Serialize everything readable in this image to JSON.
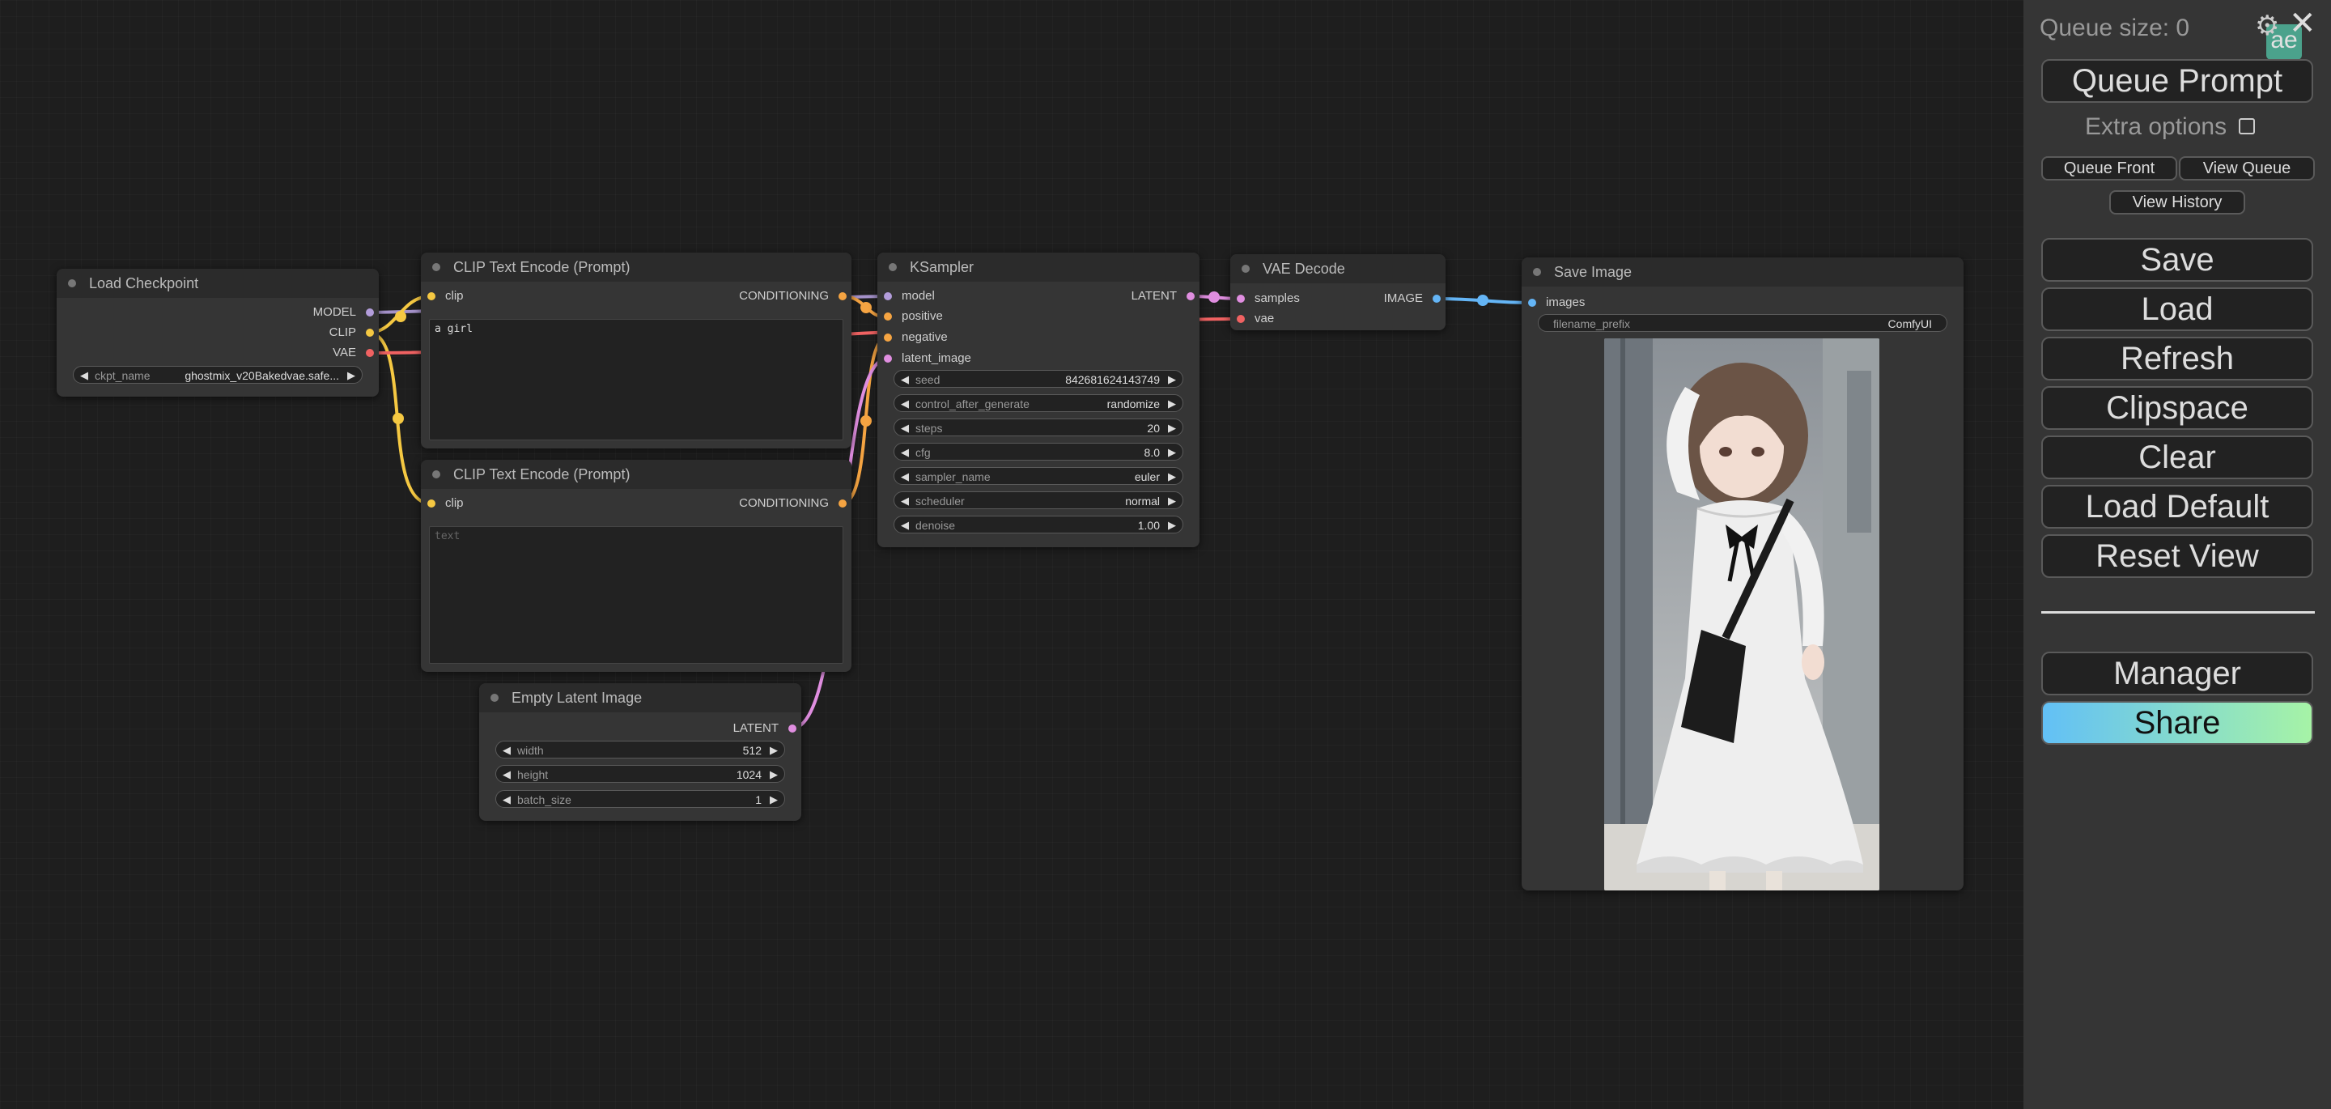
{
  "nodes": {
    "load_checkpoint": {
      "title": "Load Checkpoint",
      "outputs": [
        "MODEL",
        "CLIP",
        "VAE"
      ],
      "ckpt_label": "ckpt_name",
      "ckpt_value": "ghostmix_v20Bakedvae.safe..."
    },
    "clip_pos": {
      "title": "CLIP Text Encode (Prompt)",
      "input": "clip",
      "output": "CONDITIONING",
      "text": "a girl"
    },
    "clip_neg": {
      "title": "CLIP Text Encode (Prompt)",
      "input": "clip",
      "output": "CONDITIONING",
      "placeholder": "text"
    },
    "ksampler": {
      "title": "KSampler",
      "inputs": [
        "model",
        "positive",
        "negative",
        "latent_image"
      ],
      "output": "LATENT",
      "widgets": [
        {
          "label": "seed",
          "value": "842681624143749"
        },
        {
          "label": "control_after_generate",
          "value": "randomize"
        },
        {
          "label": "steps",
          "value": "20"
        },
        {
          "label": "cfg",
          "value": "8.0"
        },
        {
          "label": "sampler_name",
          "value": "euler"
        },
        {
          "label": "scheduler",
          "value": "normal"
        },
        {
          "label": "denoise",
          "value": "1.00"
        }
      ]
    },
    "vae_decode": {
      "title": "VAE Decode",
      "inputs": [
        "samples",
        "vae"
      ],
      "output": "IMAGE"
    },
    "save_image": {
      "title": "Save Image",
      "input": "images",
      "prefix_label": "filename_prefix",
      "prefix_value": "ComfyUI"
    },
    "empty_latent": {
      "title": "Empty Latent Image",
      "output": "LATENT",
      "widgets": [
        {
          "label": "width",
          "value": "512"
        },
        {
          "label": "height",
          "value": "1024"
        },
        {
          "label": "batch_size",
          "value": "1"
        }
      ]
    }
  },
  "colors": {
    "model": "#b39ddb",
    "clip": "#f5c842",
    "vae": "#f06262",
    "conditioning": "#f5a442",
    "latent": "#e08ee0",
    "image": "#64b5f6"
  },
  "menu": {
    "queue_size": "Queue size: 0",
    "queue_prompt": "Queue Prompt",
    "extra_options": "Extra options",
    "queue_front": "Queue Front",
    "view_queue": "View Queue",
    "view_history": "View History",
    "save": "Save",
    "load": "Load",
    "refresh": "Refresh",
    "clipspace": "Clipspace",
    "clear": "Clear",
    "load_default": "Load Default",
    "reset_view": "Reset View",
    "manager": "Manager",
    "share": "Share",
    "badge": "ae"
  }
}
